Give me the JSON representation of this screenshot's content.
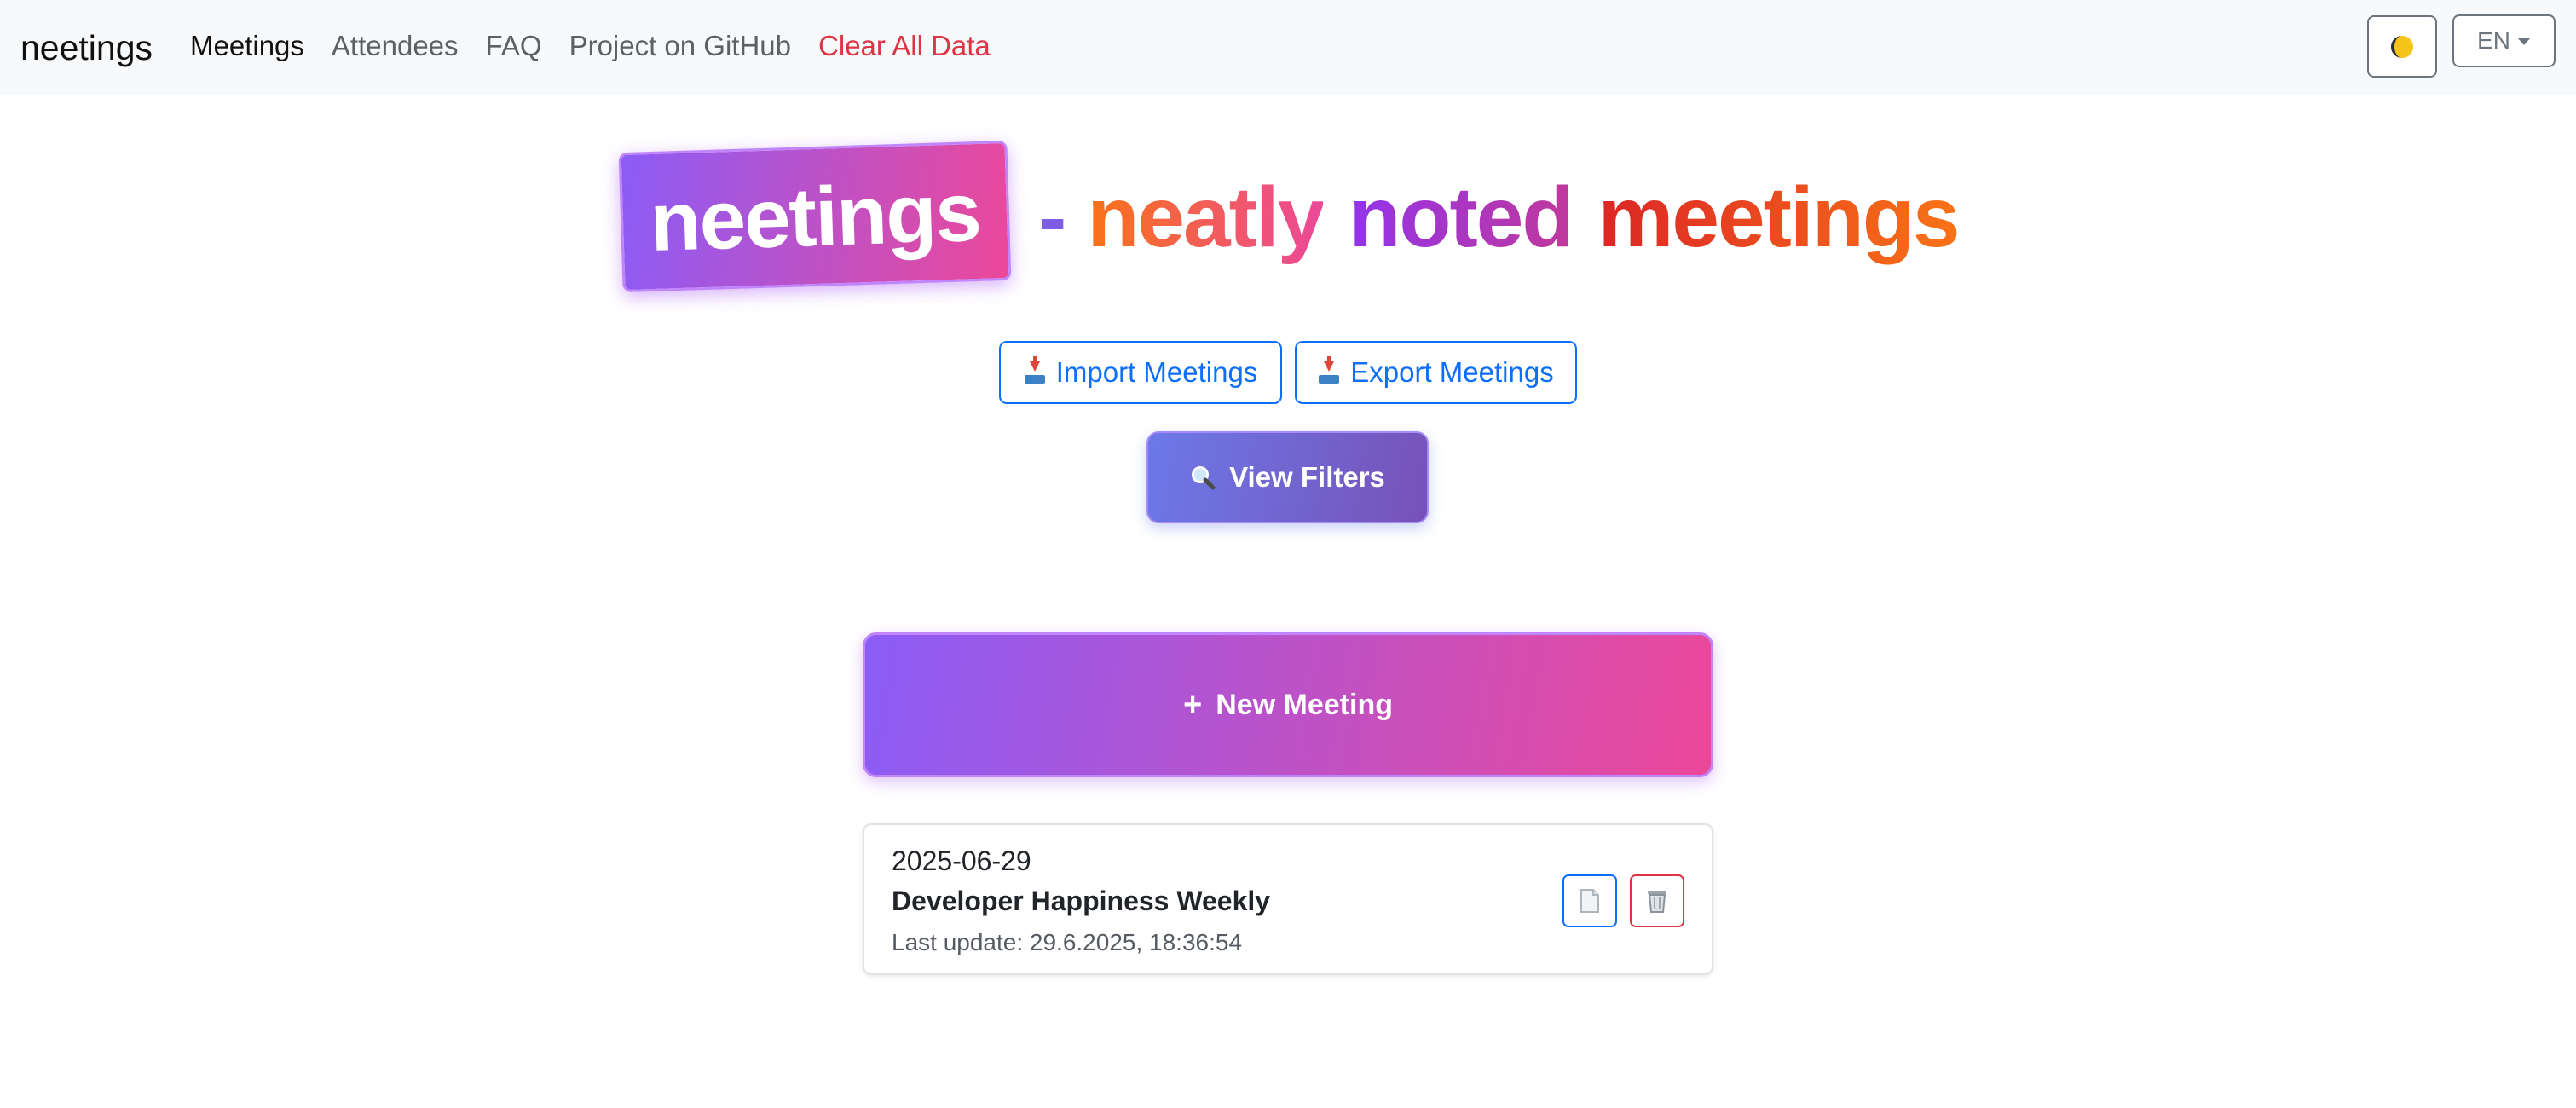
{
  "nav": {
    "brand": "neetings",
    "links": [
      "Meetings",
      "Attendees",
      "FAQ",
      "Project on GitHub",
      "Clear All Data"
    ],
    "language": "EN"
  },
  "hero": {
    "logo": "neetings",
    "dash": "-",
    "tagline_words": [
      "neatly",
      "noted",
      "meetings"
    ]
  },
  "actions": {
    "import_label": "Import Meetings",
    "export_label": "Export Meetings",
    "filters_label": "View Filters",
    "new_meeting_label": "New Meeting",
    "new_meeting_plus": "+"
  },
  "meetings": [
    {
      "date": "2025-06-29",
      "title": "Developer Happiness Weekly",
      "last_update": "Last update: 29.6.2025, 18:36:54"
    }
  ],
  "colors": {
    "danger": "#dc3545",
    "primary": "#0d6efd",
    "gradient_start": "#8b5cf6",
    "gradient_end": "#ec4899"
  }
}
